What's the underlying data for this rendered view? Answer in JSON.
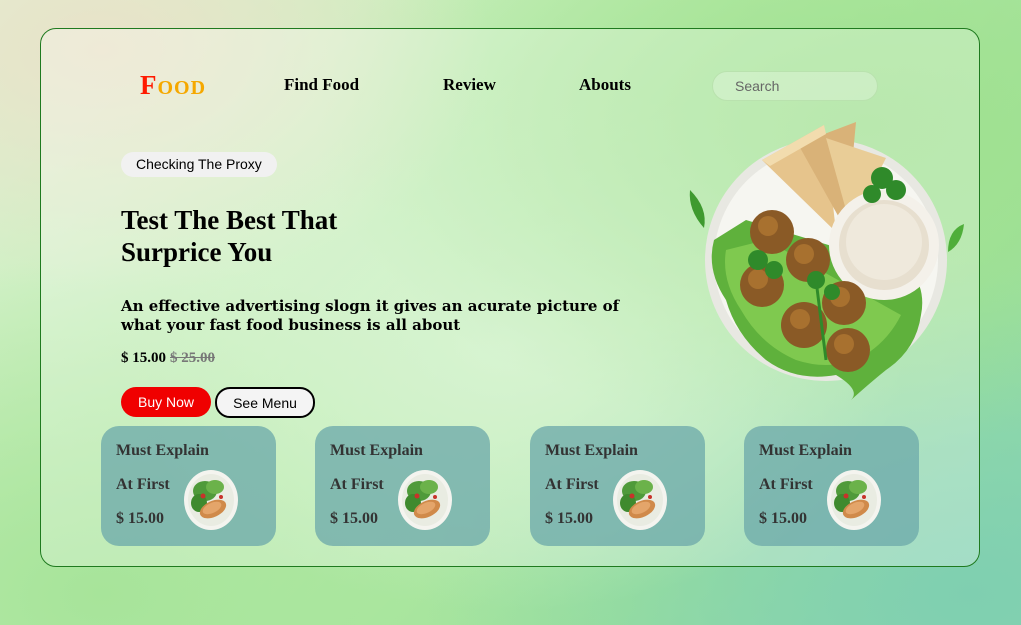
{
  "logo": {
    "first": "F",
    "rest": "OOD"
  },
  "nav": {
    "find_food": "Find Food",
    "review": "Review",
    "abouts": "Abouts"
  },
  "search": {
    "placeholder": "Search",
    "value": ""
  },
  "hero": {
    "tag": "Checking The Proxy",
    "headline_line1": "Test The Best That",
    "headline_line2": "Surprice You",
    "description": "An effective advertising slogn it gives an acurate picture of what your fast food business is all about",
    "price_now": "$ 15.00",
    "price_old": "$ 25.00",
    "buy_label": "Buy Now",
    "menu_label": "See Menu",
    "image_icon": "falafel-plate-image"
  },
  "cards": [
    {
      "title": "Must Explain",
      "subtitle": "At First",
      "price": "$ 15.00",
      "icon": "salad-plate-image"
    },
    {
      "title": "Must Explain",
      "subtitle": "At First",
      "price": "$ 15.00",
      "icon": "salad-plate-image"
    },
    {
      "title": "Must Explain",
      "subtitle": "At First",
      "price": "$ 15.00",
      "icon": "salad-plate-image"
    },
    {
      "title": "Must Explain",
      "subtitle": "At First",
      "price": "$ 15.00",
      "icon": "salad-plate-image"
    }
  ],
  "colors": {
    "logo_primary": "#ff1a00",
    "logo_secondary": "#f5a800",
    "buy_button": "#f00000",
    "panel_border": "#1f7a1f",
    "card_bg": "#6eaaaa"
  }
}
